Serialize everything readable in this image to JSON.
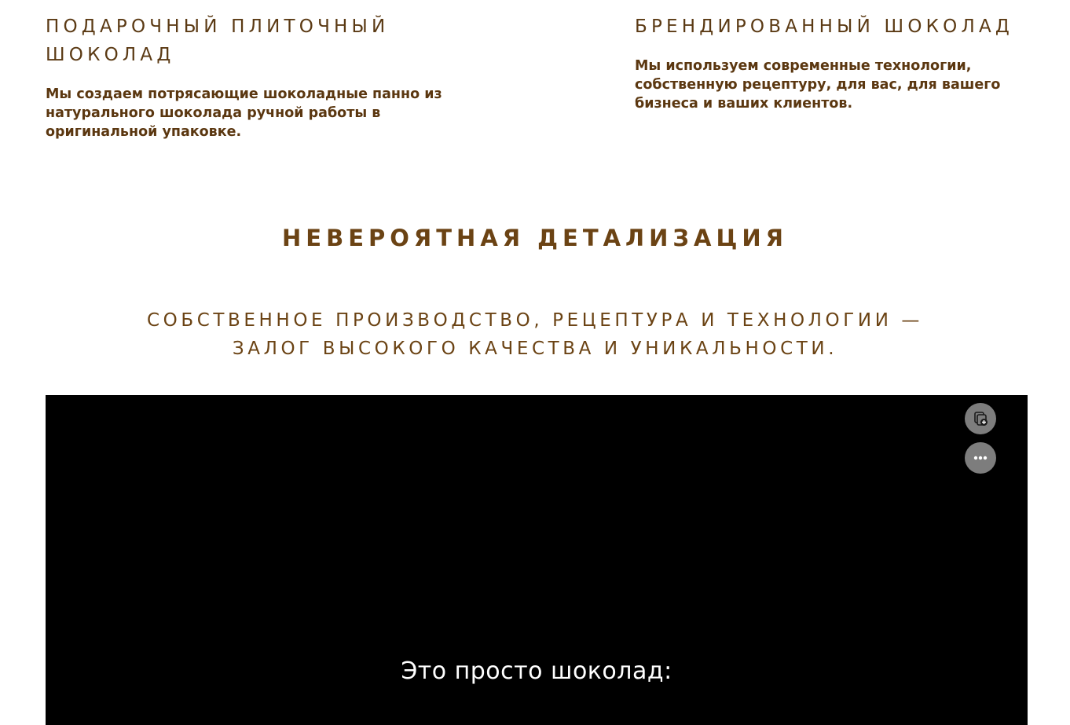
{
  "features": {
    "left": {
      "title": "ПОДАРОЧНЫЙ ПЛИТОЧНЫЙ ШОКОЛАД",
      "text": "Мы создаем потрясающие шоколадные панно из натурального шоколада ручной работы в оригинальной упаковке."
    },
    "right": {
      "title": "БРЕНДИРОВАННЫЙ ШОКОЛАД",
      "text": "Мы используем современные технологии, собственную рецептуру, для вас, для вашего бизнеса и ваших клиентов."
    }
  },
  "section": {
    "title": "НЕВЕРОЯТНАЯ ДЕТАЛИЗАЦИЯ",
    "subtitle_line1": "СОБСТВЕННОЕ ПРОИЗВОДСТВО, РЕЦЕПТУРА И ТЕХНОЛОГИИ —",
    "subtitle_line2": "ЗАЛОГ ВЫСОКОГО КАЧЕСТВА И УНИКАЛЬНОСТИ."
  },
  "video": {
    "caption": "Это просто шоколад:",
    "save_icon": "save-to-collection-icon",
    "more_icon": "more-options-icon"
  },
  "colors": {
    "accent": "#6b4314",
    "text_dark": "#5b3710",
    "video_bg": "#000000",
    "button_bg": "#7d7d7d"
  }
}
